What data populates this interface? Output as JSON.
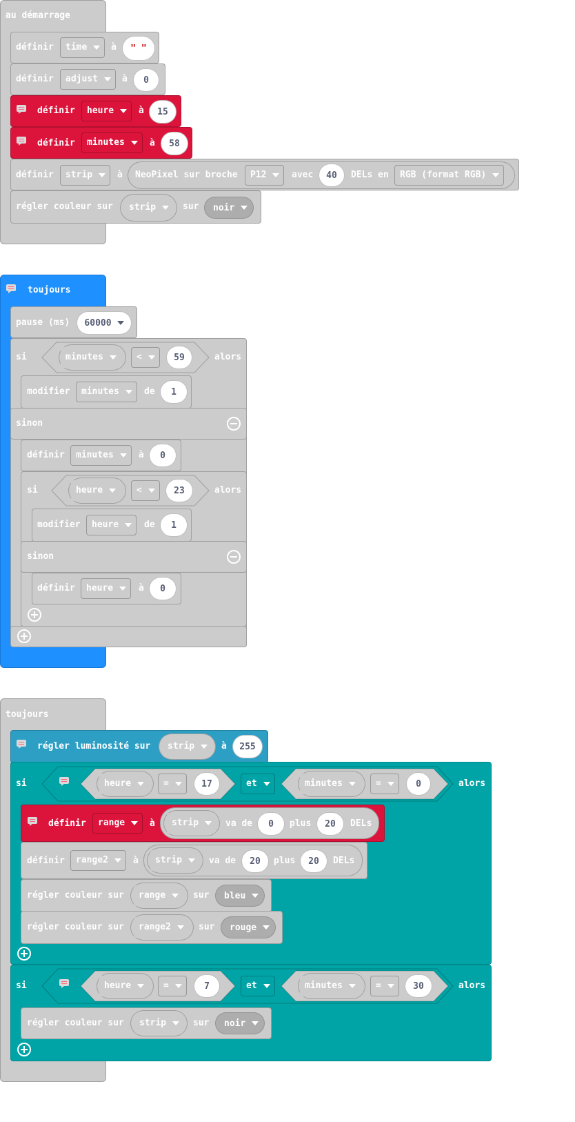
{
  "event1": {
    "title": "au démarrage",
    "rows": {
      "r1": {
        "kw": "définir",
        "var": "time",
        "to": "à",
        "val": "\" \""
      },
      "r2": {
        "kw": "définir",
        "var": "adjust",
        "to": "à",
        "val": "0"
      },
      "r3": {
        "kw": "définir",
        "var": "heure",
        "to": "à",
        "val": "15"
      },
      "r4": {
        "kw": "définir",
        "var": "minutes",
        "to": "à",
        "val": "58"
      },
      "r5": {
        "kw": "définir",
        "var": "strip",
        "to": "à",
        "create": "NeoPixel sur broche",
        "pin": "P12",
        "with": "avec",
        "count": "40",
        "leds": "DELs en",
        "mode": "RGB (format RGB)"
      },
      "r6": {
        "kw": "régler couleur sur",
        "var": "strip",
        "on": "sur",
        "color": "noir"
      }
    }
  },
  "event2": {
    "title": "toujours",
    "pause": {
      "kw": "pause (ms)",
      "val": "60000"
    },
    "if1": {
      "kw": "si",
      "var": "minutes",
      "op": "<",
      "val": "59",
      "then": "alors"
    },
    "mod1": {
      "kw": "modifier",
      "var": "minutes",
      "by": "de",
      "val": "1"
    },
    "else1": "sinon",
    "set1": {
      "kw": "définir",
      "var": "minutes",
      "to": "à",
      "val": "0"
    },
    "if2": {
      "kw": "si",
      "var": "heure",
      "op": "<",
      "val": "23",
      "then": "alors"
    },
    "mod2": {
      "kw": "modifier",
      "var": "heure",
      "by": "de",
      "val": "1"
    },
    "else2": "sinon",
    "set2": {
      "kw": "définir",
      "var": "heure",
      "to": "à",
      "val": "0"
    }
  },
  "event3": {
    "title": "toujours",
    "bright": {
      "kw": "régler luminosité sur",
      "var": "strip",
      "to": "à",
      "val": "255"
    },
    "if1": {
      "kw": "si",
      "a_var": "heure",
      "a_op": "=",
      "a_val": "17",
      "and": "et",
      "b_var": "minutes",
      "b_op": "=",
      "b_val": "0",
      "then": "alors"
    },
    "set_range": {
      "kw": "définir",
      "var": "range",
      "to": "à",
      "src": "strip",
      "from": "va de",
      "start": "0",
      "plus": "plus",
      "len": "20",
      "leds": "DELs"
    },
    "set_range2": {
      "kw": "définir",
      "var": "range2",
      "to": "à",
      "src": "strip",
      "from": "va de",
      "start": "20",
      "plus": "plus",
      "len": "20",
      "leds": "DELs"
    },
    "color1": {
      "kw": "régler couleur sur",
      "var": "range",
      "on": "sur",
      "color": "bleu"
    },
    "color2": {
      "kw": "régler couleur sur",
      "var": "range2",
      "on": "sur",
      "color": "rouge"
    },
    "if2": {
      "kw": "si",
      "a_var": "heure",
      "a_op": "=",
      "a_val": "7",
      "and": "et",
      "b_var": "minutes",
      "b_op": "=",
      "b_val": "30",
      "then": "alors"
    },
    "color3": {
      "kw": "régler couleur sur",
      "var": "strip",
      "on": "sur",
      "color": "noir"
    }
  },
  "colors": {
    "grey": "#cccccc",
    "red": "#dc143c",
    "blue": "#1e90ff",
    "teal": "#00a4a6",
    "steel": "#2e9fc4"
  }
}
